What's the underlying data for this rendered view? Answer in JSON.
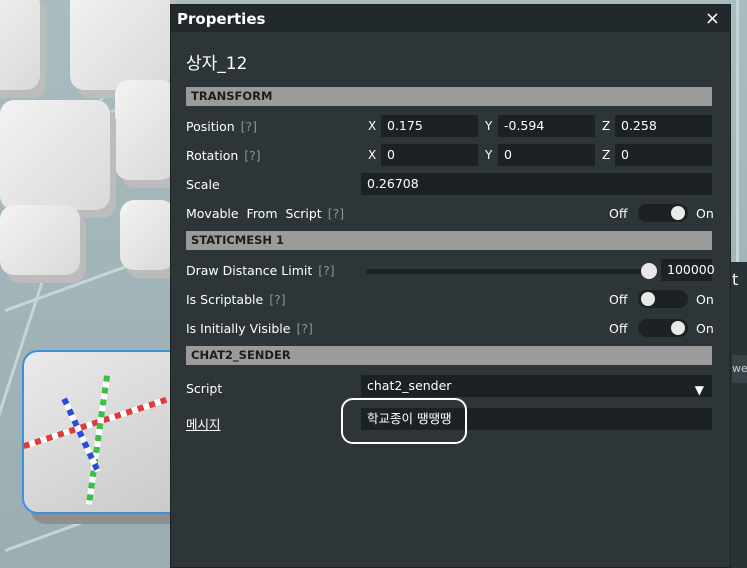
{
  "panel": {
    "title": "Properties",
    "close_icon": "×",
    "object_name": "상자_12"
  },
  "transform": {
    "header": "TRANSFORM",
    "position": {
      "label": "Position",
      "hint": "[?]",
      "x_axis": "X",
      "x": "0.175",
      "y_axis": "Y",
      "y": "-0.594",
      "z_axis": "Z",
      "z": "0.258"
    },
    "rotation": {
      "label": "Rotation",
      "hint": "[?]",
      "x_axis": "X",
      "x": "0",
      "y_axis": "Y",
      "y": "0",
      "z_axis": "Z",
      "z": "0"
    },
    "scale": {
      "label": "Scale",
      "value": "0.26708"
    },
    "movable": {
      "label": "Movable  From  Script",
      "hint": "[?]",
      "off": "Off",
      "on": "On",
      "state": "on"
    }
  },
  "staticmesh": {
    "header": "STATICMESH 1",
    "draw_distance": {
      "label": "Draw Distance Limit",
      "hint": "[?]",
      "value": "100000",
      "level": 1.0
    },
    "scriptable": {
      "label": "Is Scriptable",
      "hint": "[?]",
      "off": "Off",
      "on": "On",
      "state": "off"
    },
    "visible": {
      "label": "Is Initially Visible",
      "hint": "[?]",
      "off": "Off",
      "on": "On",
      "state": "on"
    }
  },
  "chat": {
    "header": "CHAT2_SENDER",
    "script": {
      "label": "Script",
      "value": "chat2_sender",
      "arrow": "▼"
    },
    "message": {
      "label": "메시지",
      "value": "학교종이 땡땡땡"
    }
  },
  "side_panel": {
    "title_fragment": "t",
    "item_fragment": "we"
  },
  "colors": {
    "panel_bg": "#2e3538",
    "section_bg": "#9b9b9b",
    "field_bg": "#1c2124",
    "selection": "#3d8fe0"
  }
}
